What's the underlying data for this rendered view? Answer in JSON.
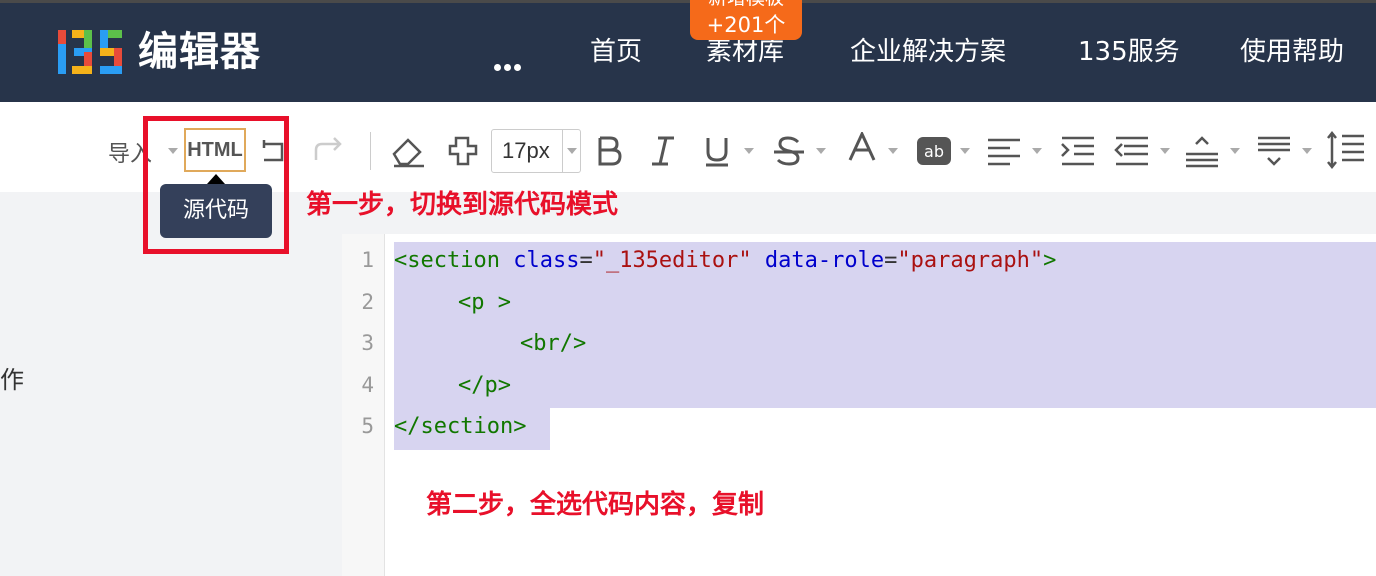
{
  "header": {
    "logo_number": "135",
    "logo_text": "编辑器",
    "nav": [
      "首页",
      "素材库",
      "企业解决方案",
      "135服务",
      "使用帮助"
    ],
    "badge_top": "新增模板",
    "badge_count": "+201个"
  },
  "toolbar": {
    "import_label": "导入",
    "html_label": "HTML",
    "font_size": "17px",
    "tooltip": "源代码"
  },
  "sidebar": {
    "partial_text": "作"
  },
  "annotations": {
    "step1": "第一步，切换到源代码模式",
    "step2": "第二步，全选代码内容，复制"
  },
  "code": {
    "line_numbers": [
      "1",
      "2",
      "3",
      "4",
      "5"
    ],
    "l1_open": "<section",
    "l1_attr1": "class",
    "l1_val1": "\"_135editor\"",
    "l1_attr2": "data-role",
    "l1_val2": "\"paragraph\"",
    "l1_close": ">",
    "l2": "<p >",
    "l3": "<br/>",
    "l4": "</p>",
    "l5": "</section>"
  },
  "colors": {
    "header_bg": "#27344a",
    "badge": "#f56a1a",
    "annotation_red": "#e8102a",
    "selection": "#d7d4f0",
    "html_btn_border": "#e0a95b"
  }
}
